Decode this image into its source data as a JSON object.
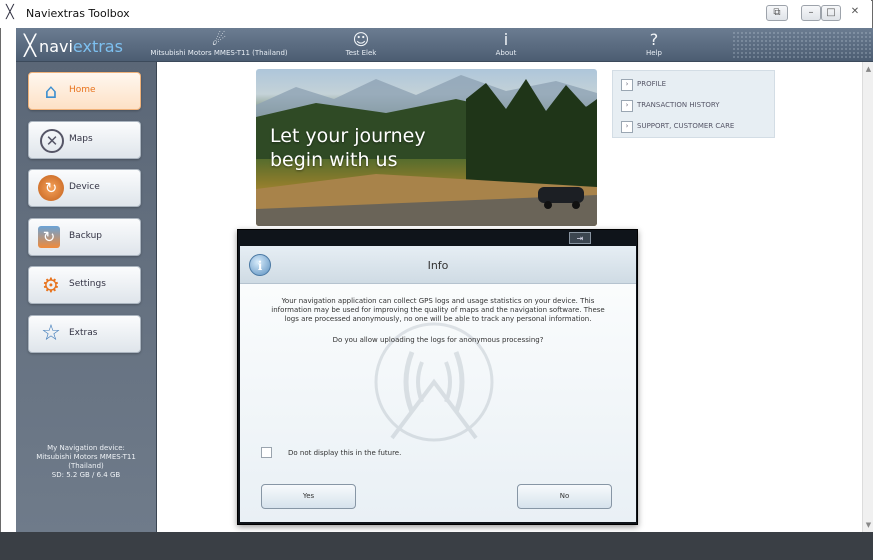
{
  "window": {
    "title": "Naviextras Toolbox",
    "controls": {
      "extra": "⧉",
      "minimize": "–",
      "maximize": "□",
      "close": "✕"
    }
  },
  "topbar": {
    "logo_x": "╳",
    "logo_a": "navi",
    "logo_b": "extras",
    "items": [
      {
        "icon": "satellite-icon",
        "glyph": "☄",
        "label": "Mitsubishi Motors MMES-T11 (Thailand)"
      },
      {
        "icon": "user-icon",
        "glyph": "☺",
        "label": "Test Elek"
      },
      {
        "icon": "info-icon",
        "glyph": "i",
        "label": "About"
      },
      {
        "icon": "help-icon",
        "glyph": "?",
        "label": "Help"
      }
    ]
  },
  "sidebar": {
    "items": [
      {
        "label": "Home",
        "icon": "home-icon",
        "glyph": "⌂",
        "active": true
      },
      {
        "label": "Maps",
        "icon": "maps-icon",
        "glyph": "✕"
      },
      {
        "label": "Device",
        "icon": "device-icon",
        "glyph": "↻"
      },
      {
        "label": "Backup",
        "icon": "backup-icon",
        "glyph": "↻"
      },
      {
        "label": "Settings",
        "icon": "settings-icon",
        "glyph": "⚙"
      },
      {
        "label": "Extras",
        "icon": "star-icon",
        "glyph": "☆"
      }
    ],
    "device_info": [
      "My Navigation device:",
      "Mitsubishi Motors MMES-T11",
      "(Thailand)",
      "SD: 5.2 GB / 6.4 GB"
    ]
  },
  "banner": {
    "line1": "Let your journey",
    "line2": "begin with us"
  },
  "links": [
    {
      "chevron": "›",
      "label": "PROFILE"
    },
    {
      "chevron": "›",
      "label": "TRANSACTION HISTORY"
    },
    {
      "chevron": "›",
      "label": "SUPPORT, CUSTOMER CARE"
    }
  ],
  "dialog": {
    "title": "Info",
    "icon_glyph": "i",
    "body": "Your navigation application can collect GPS logs and usage statistics on your device. This information may be used for improving the quality of maps and the navigation software. These logs are processed anonymously, no one will be able to track any personal information.",
    "question": "Do you allow uploading the logs for anonymous processing?",
    "checkbox_label": "Do not display this in the future.",
    "checkbox_checked": false,
    "yes_label": "Yes",
    "no_label": "No",
    "restore_glyph": "⇥"
  },
  "scrollbar": {
    "up": "▲",
    "down": "▼"
  },
  "colors": {
    "accent": "#e8741e",
    "topbar": "#5b6b80",
    "panel": "#667283"
  }
}
